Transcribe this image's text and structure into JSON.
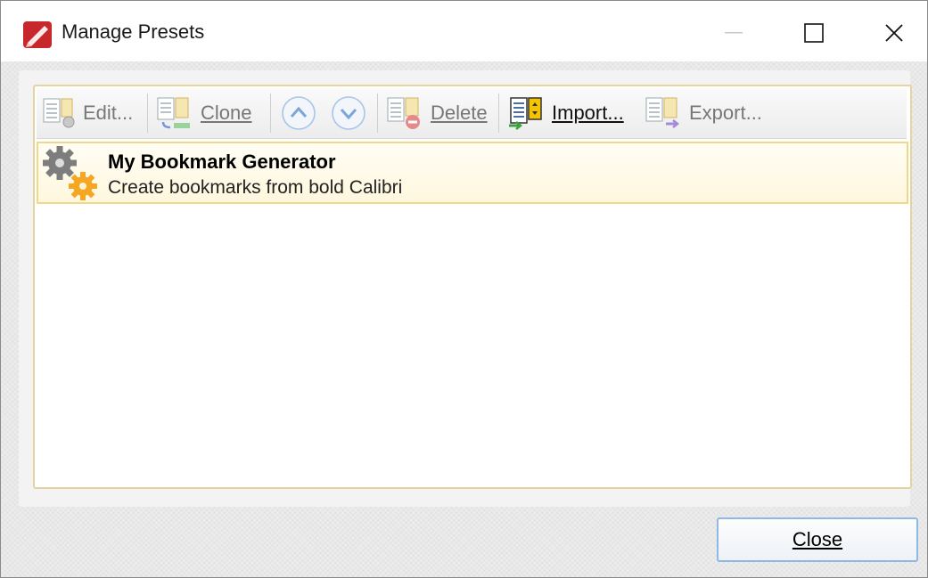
{
  "window": {
    "title": "Manage Presets",
    "app_icon": "pdf-editor-icon"
  },
  "toolbar": {
    "edit_label": "Edit...",
    "clone_label": "Clone",
    "move_up_icon": "chevron-up-icon",
    "move_down_icon": "chevron-down-icon",
    "delete_label": "Delete",
    "import_label": "Import...",
    "export_label": "Export..."
  },
  "presets": [
    {
      "name": "My Bookmark Generator",
      "description": "Create bookmarks from bold Calibri",
      "icon": "gears-icon"
    }
  ],
  "footer": {
    "close_label": "Close"
  },
  "colors": {
    "selection_border": "#efd88a",
    "frame_border": "#e5d3a0",
    "button_focus": "#8fb8e6"
  }
}
